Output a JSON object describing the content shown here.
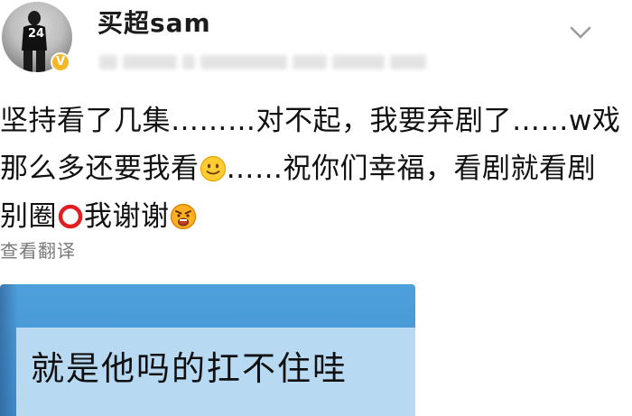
{
  "post": {
    "author": {
      "name": "买超sam",
      "avatar_number": "24",
      "verified_badge": "V",
      "avatar_icon": "basketball-player-avatar-icon",
      "badge_color": "#f4b728"
    },
    "menu_icon": "chevron-down-icon",
    "content_lines": [
      "坚持看了几集………对不起，我要弃剧了……w戏",
      "那么多还要我看",
      "……祝你们幸福，看剧就看剧",
      "别圈",
      "我谢谢"
    ],
    "emojis": [
      "smile-emoji-icon",
      "red-circle-icon",
      "angry-emoji-icon"
    ],
    "translate_label": "查看翻译",
    "image": {
      "caption": "就是他吗的扛不住哇",
      "background_color": "#4ea0dc"
    }
  }
}
